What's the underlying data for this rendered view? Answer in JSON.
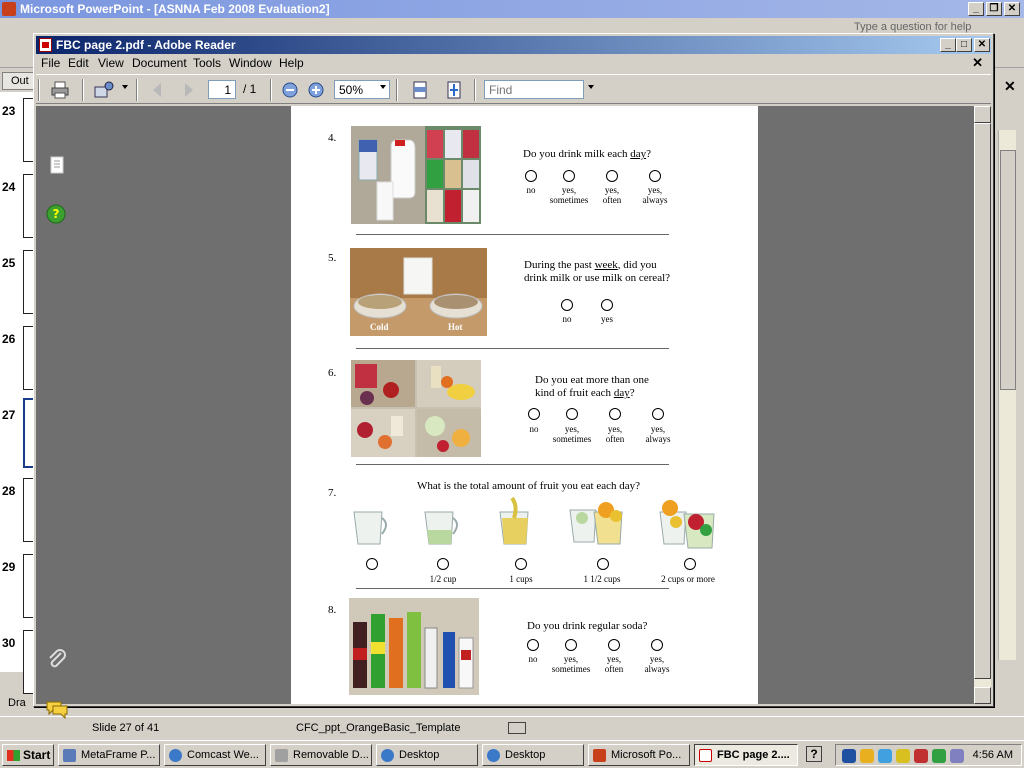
{
  "powerpoint": {
    "title": "Microsoft PowerPoint - [ASNNA Feb 2008 Evaluation2]",
    "help_placeholder": "Type a question for help",
    "outline_tab": "Out",
    "slide_numbers": [
      "23",
      "24",
      "25",
      "26",
      "27",
      "28",
      "29",
      "30"
    ],
    "selected_slide": "27",
    "status_slide": "Slide 27 of 41",
    "status_template": "CFC_ppt_OrangeBasic_Template",
    "draw_label": "Dra"
  },
  "reader": {
    "title": "FBC page 2.pdf - Adobe Reader",
    "menu": [
      "File",
      "Edit",
      "View",
      "Document",
      "Tools",
      "Window",
      "Help"
    ],
    "doc_close": "✕",
    "page_current": "1",
    "page_total": "/ 1",
    "zoom": "50%",
    "find_placeholder": "Find"
  },
  "page": {
    "q4": {
      "number": "4.",
      "text_before": "Do you drink milk each ",
      "text_underline": "day",
      "text_after": "?",
      "options": [
        "no",
        "yes,\nsometimes",
        "yes,\noften",
        "yes,\nalways"
      ]
    },
    "q5": {
      "number": "5.",
      "line1_before": "During the past ",
      "line1_underline": "week",
      "line1_after": ", did you",
      "line2": "drink milk or use milk on cereal?",
      "options": [
        "no",
        "yes"
      ],
      "photo_labels": [
        "Cold",
        "Hot"
      ]
    },
    "q6": {
      "number": "6.",
      "line1": "Do you eat more than one",
      "line2_before": "kind of fruit each ",
      "line2_underline": "day",
      "line2_after": "?",
      "options": [
        "no",
        "yes,\nsometimes",
        "yes,\noften",
        "yes,\nalways"
      ]
    },
    "q7": {
      "number": "7.",
      "text": "What is the total amount of fruit you eat each day?",
      "options": [
        "",
        "1/2 cup",
        "1 cups",
        "1 1/2 cups",
        "2 cups or more"
      ]
    },
    "q8": {
      "number": "8.",
      "text": "Do you drink regular soda?",
      "options": [
        "no",
        "yes,\nsometimes",
        "yes,\noften",
        "yes,\nalways"
      ]
    }
  },
  "taskbar": {
    "start": "Start",
    "buttons": [
      "MetaFrame P...",
      "Comcast We...",
      "Removable D...",
      "Desktop",
      "Desktop",
      "Microsoft Po...",
      "FBC page 2...."
    ],
    "active_index": 6,
    "clock": "4:56 AM"
  },
  "colors": {
    "reader_title": "#0a246a",
    "ppt_title": "#7a96df",
    "doc_background": "#6f6f6f"
  }
}
